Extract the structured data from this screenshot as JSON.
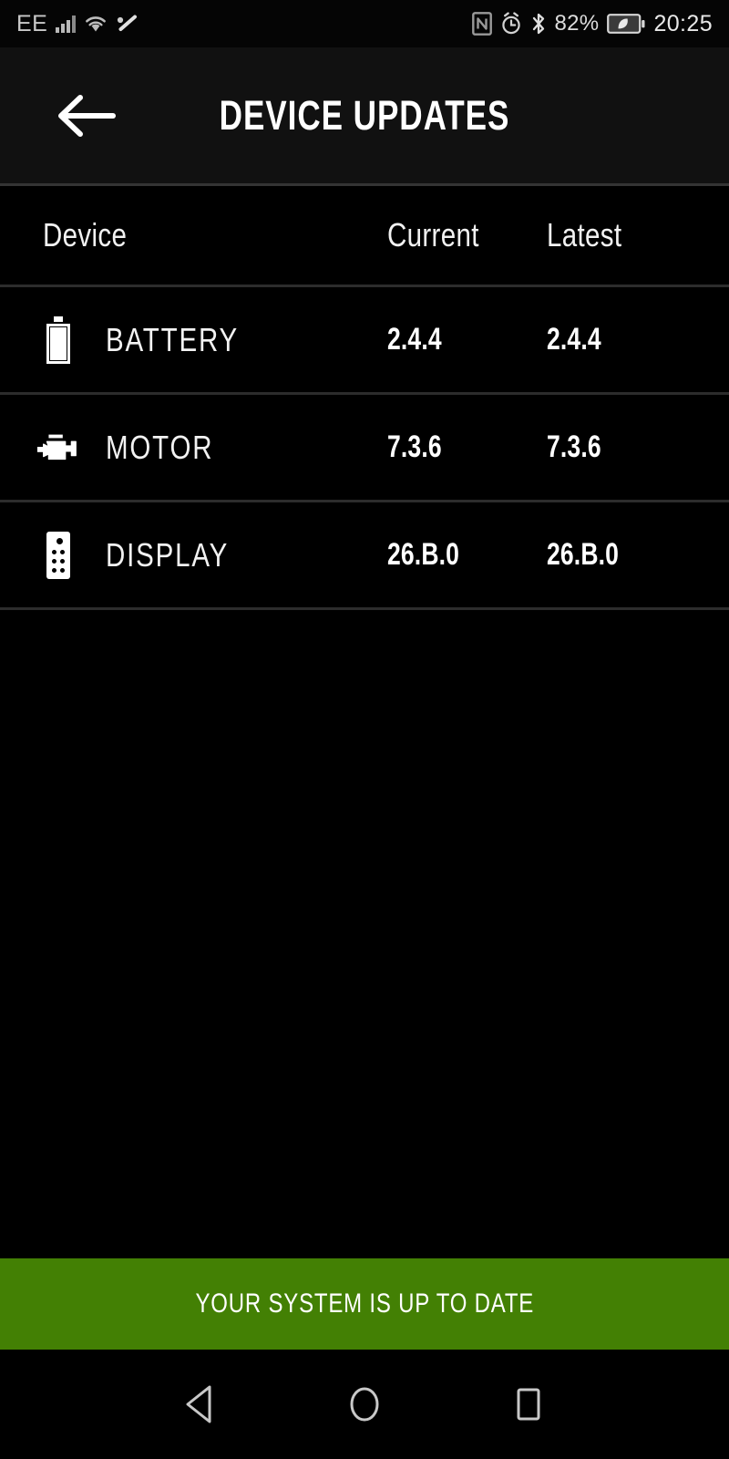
{
  "status_bar": {
    "carrier": "EE",
    "battery_percent": "82%",
    "clock": "20:25",
    "icons": {
      "signal": "signal-bars-icon",
      "wifi": "wifi-icon",
      "sync": "data-sync-icon",
      "nfc": "nfc-icon",
      "alarm": "alarm-clock-icon",
      "bluetooth": "bluetooth-icon",
      "battery": "battery-saver-icon"
    }
  },
  "app_bar": {
    "title": "DEVICE UPDATES",
    "back_label": "back-arrow"
  },
  "table": {
    "headers": {
      "device": "Device",
      "current": "Current",
      "latest": "Latest"
    },
    "rows": [
      {
        "icon": "battery-icon",
        "name": "BATTERY",
        "current": "2.4.4",
        "latest": "2.4.4"
      },
      {
        "icon": "engine-icon",
        "name": "MOTOR",
        "current": "7.3.6",
        "latest": "7.3.6"
      },
      {
        "icon": "display-icon",
        "name": "DISPLAY",
        "current": "26.B.0",
        "latest": "26.B.0"
      }
    ]
  },
  "banner": {
    "text": "YOUR SYSTEM IS UP TO DATE",
    "color": "#438004"
  },
  "nav_bar": {
    "back": "nav-back-triangle",
    "home": "nav-home-circle",
    "recents": "nav-recents-square"
  },
  "theme": {
    "background": "#000000",
    "app_bar_background": "#111111",
    "divider": "#2c2c2c",
    "text": "#ffffff",
    "accent_green": "#438004"
  }
}
